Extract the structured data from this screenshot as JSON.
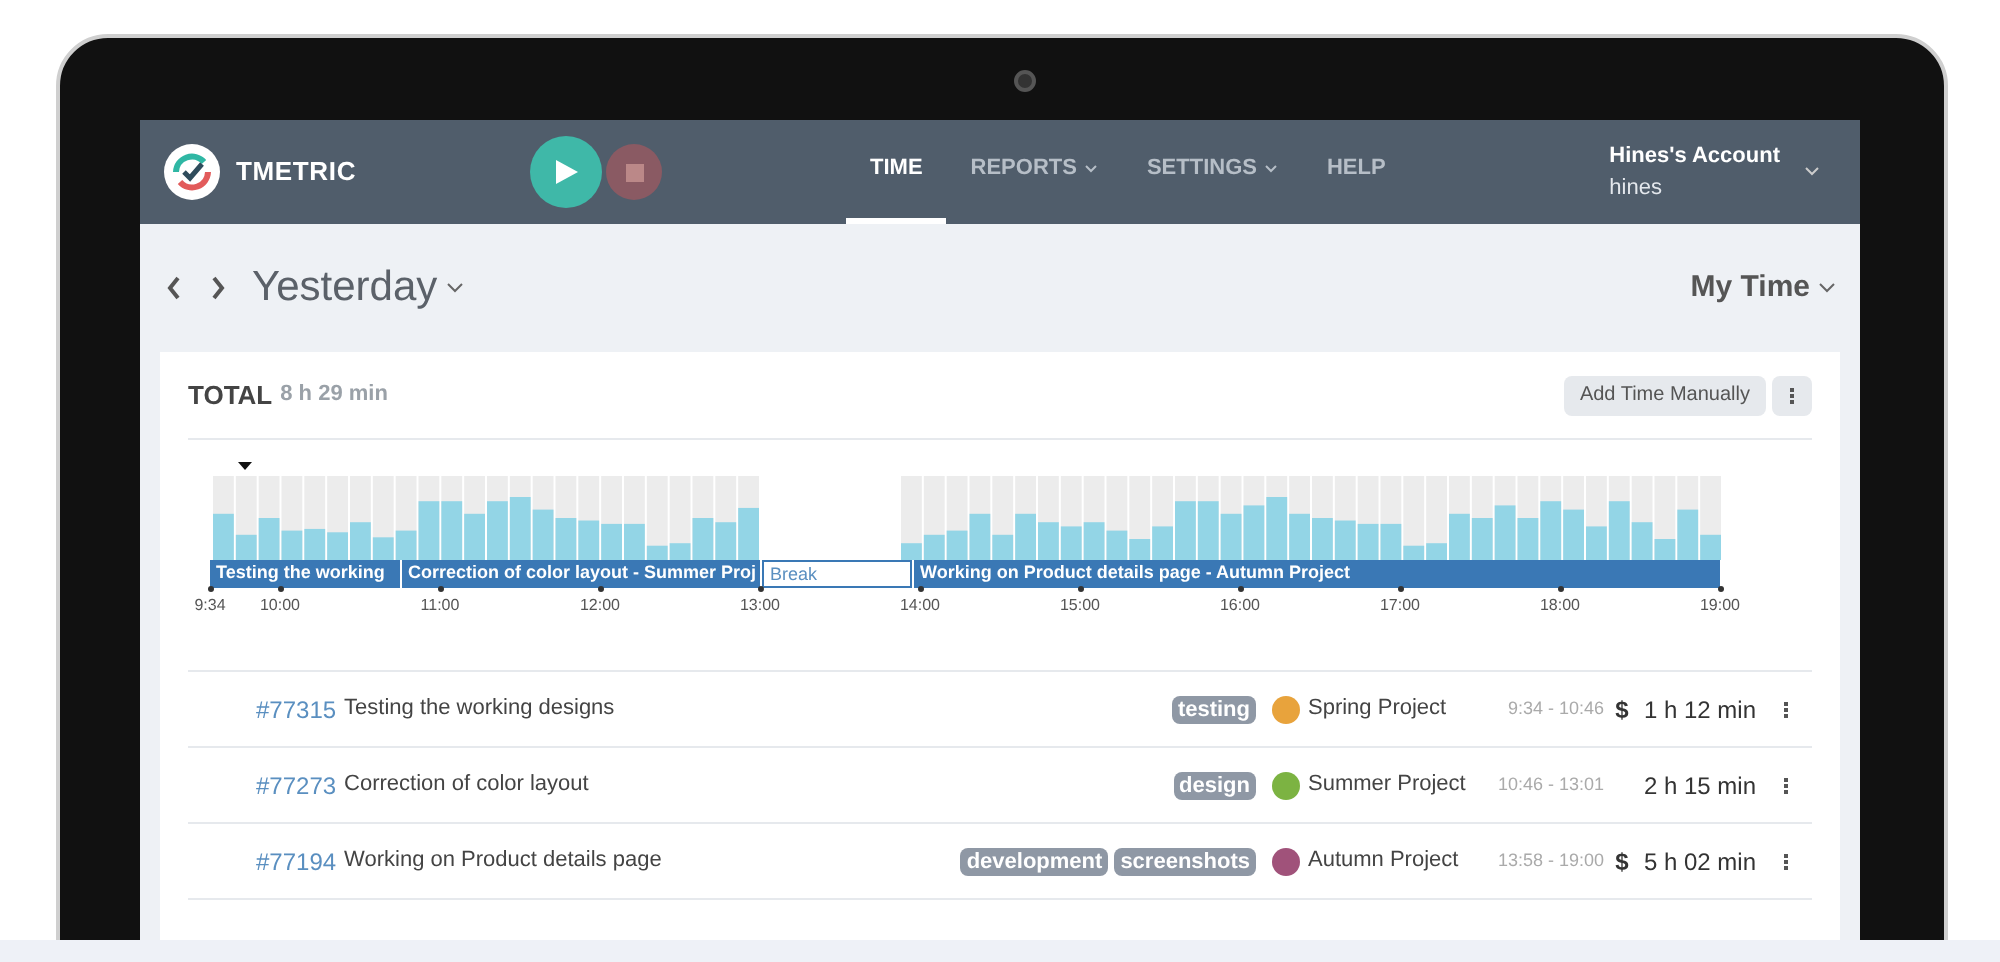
{
  "header": {
    "logo": "TMETRIC",
    "timer_running": false,
    "nav": [
      {
        "label": "TIME",
        "selected": true,
        "dropdown": false
      },
      {
        "label": "REPORTS",
        "selected": false,
        "dropdown": true
      },
      {
        "label": "SETTINGS",
        "selected": false,
        "dropdown": true
      },
      {
        "label": "HELP",
        "selected": false,
        "dropdown": false
      }
    ],
    "account": {
      "name": "Hines's Account",
      "user": "hines"
    }
  },
  "toolbar": {
    "period": "Yesterday",
    "view": "My Time"
  },
  "summary": {
    "label": "TOTAL",
    "value": "8 h 29 min",
    "add_button": "Add Time Manually"
  },
  "timeline": {
    "segments": [
      {
        "kind": "task",
        "label": "Testing the working"
      },
      {
        "kind": "task",
        "label": "Correction of color layout - Summer Proj"
      },
      {
        "kind": "break",
        "label": "Break"
      },
      {
        "kind": "task",
        "label": "Working on Product details page - Autumn Project"
      }
    ],
    "ticks": [
      "9:34",
      "10:00",
      "11:00",
      "12:00",
      "13:00",
      "14:00",
      "15:00",
      "16:00",
      "17:00",
      "18:00",
      "19:00"
    ]
  },
  "entries": [
    {
      "id": "#77315",
      "title": "Testing the working designs",
      "tags": [
        "testing"
      ],
      "project": "Spring Project",
      "color": "#e8a33c",
      "range": "9:34 - 10:46",
      "billable": "$",
      "duration": "1 h 12 min"
    },
    {
      "id": "#77273",
      "title": "Correction of color layout",
      "tags": [
        "design"
      ],
      "project": "Summer Project",
      "color": "#7cb342",
      "range": "10:46 - 13:01",
      "duration": "2 h 15 min"
    },
    {
      "id": "#77194",
      "title": "Working on Product details page",
      "tags": [
        "development",
        "screenshots"
      ],
      "project": "Autumn Project",
      "color": "#a0527a",
      "range": "13:58 - 19:00",
      "billable": "$",
      "duration": "5 h 02 min"
    }
  ]
}
